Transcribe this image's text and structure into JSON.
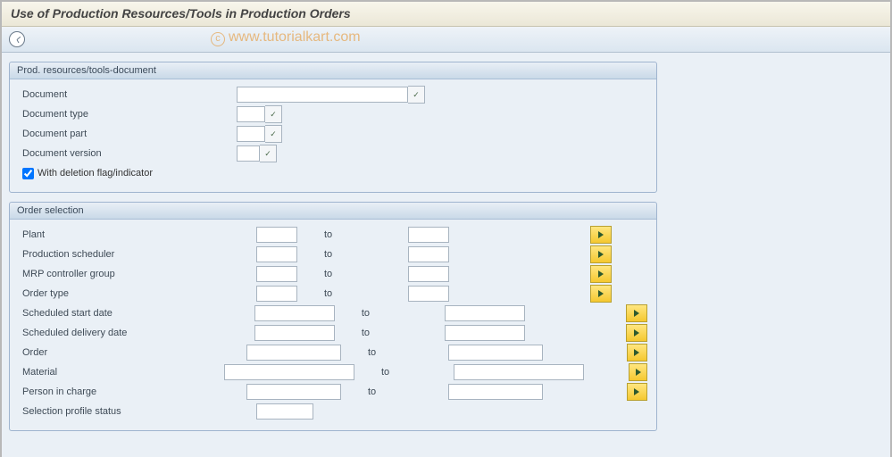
{
  "title": "Use of Production Resources/Tools in Production Orders",
  "watermark": "www.tutorialkart.com",
  "group_doc": {
    "header": "Prod. resources/tools-document",
    "rows": {
      "document": "Document",
      "doc_type": "Document type",
      "doc_part": "Document part",
      "doc_version": "Document version"
    },
    "with_deletion_label": "With deletion flag/indicator",
    "with_deletion_checked": true,
    "values": {
      "document": "",
      "doc_type": "",
      "doc_part": "",
      "doc_version": ""
    }
  },
  "group_order": {
    "header": "Order selection",
    "to_label": "to",
    "rows": [
      {
        "key": "plant",
        "label": "Plant",
        "w_from": 40,
        "w_to": 40,
        "gap": 158,
        "multi": true
      },
      {
        "key": "prod_scheduler",
        "label": "Production scheduler",
        "w_from": 40,
        "w_to": 40,
        "gap": 158,
        "multi": true
      },
      {
        "key": "mrp_group",
        "label": "MRP controller group",
        "w_from": 40,
        "w_to": 40,
        "gap": 158,
        "multi": true
      },
      {
        "key": "order_type",
        "label": "Order type",
        "w_from": 40,
        "w_to": 40,
        "gap": 158,
        "multi": true
      },
      {
        "key": "sched_start",
        "label": "Scheduled start date",
        "w_from": 84,
        "w_to": 84,
        "gap": 114,
        "multi": true
      },
      {
        "key": "sched_delivery",
        "label": "Scheduled delivery date",
        "w_from": 84,
        "w_to": 84,
        "gap": 114,
        "multi": true
      },
      {
        "key": "order",
        "label": "Order",
        "w_from": 100,
        "w_to": 100,
        "gap": 98,
        "multi": true
      },
      {
        "key": "material",
        "label": "Material",
        "w_from": 140,
        "w_to": 140,
        "gap": 58,
        "multi": true
      },
      {
        "key": "person",
        "label": "Person in charge",
        "w_from": 100,
        "w_to": 100,
        "gap": 98,
        "multi": true
      },
      {
        "key": "sel_profile",
        "label": "Selection profile status",
        "w_from": 58,
        "w_to": null,
        "gap": 0,
        "multi": false
      }
    ],
    "values": {}
  }
}
